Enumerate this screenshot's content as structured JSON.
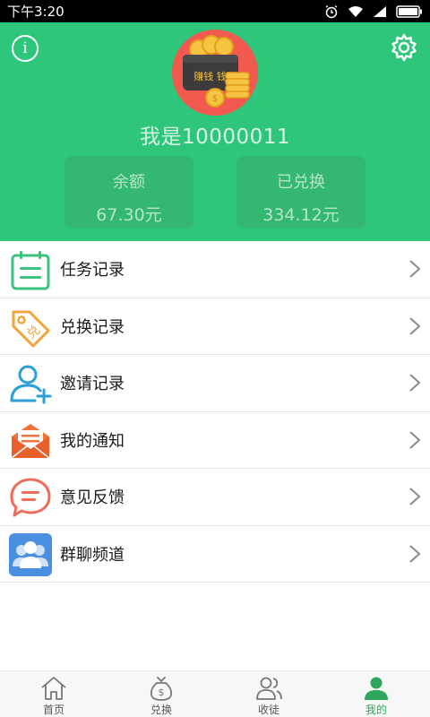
{
  "status_bar": {
    "time": "下午3:20"
  },
  "header": {
    "username": "我是10000011",
    "balance": {
      "label": "余额",
      "value": "67.30元"
    },
    "exchanged": {
      "label": "已兑换",
      "value": "334.12元"
    },
    "avatar_text": "赚钱 钱赚",
    "colors": {
      "background": "#2ec67a",
      "box": "#34b871"
    }
  },
  "menu": {
    "items": [
      {
        "label": "任务记录",
        "icon": "clipboard-icon"
      },
      {
        "label": "兑换记录",
        "icon": "price-tag-icon"
      },
      {
        "label": "邀请记录",
        "icon": "add-user-icon"
      },
      {
        "label": "我的通知",
        "icon": "envelope-icon"
      },
      {
        "label": "意见反馈",
        "icon": "chat-bubble-icon"
      },
      {
        "label": "群聊频道",
        "icon": "group-icon"
      }
    ]
  },
  "bottom_nav": {
    "items": [
      {
        "label": "首页",
        "icon": "home-icon"
      },
      {
        "label": "兑换",
        "icon": "money-bag-icon"
      },
      {
        "label": "收徒",
        "icon": "people-icon"
      },
      {
        "label": "我的",
        "icon": "person-icon"
      }
    ],
    "active_index": 3,
    "active_color": "#2ea65e"
  }
}
